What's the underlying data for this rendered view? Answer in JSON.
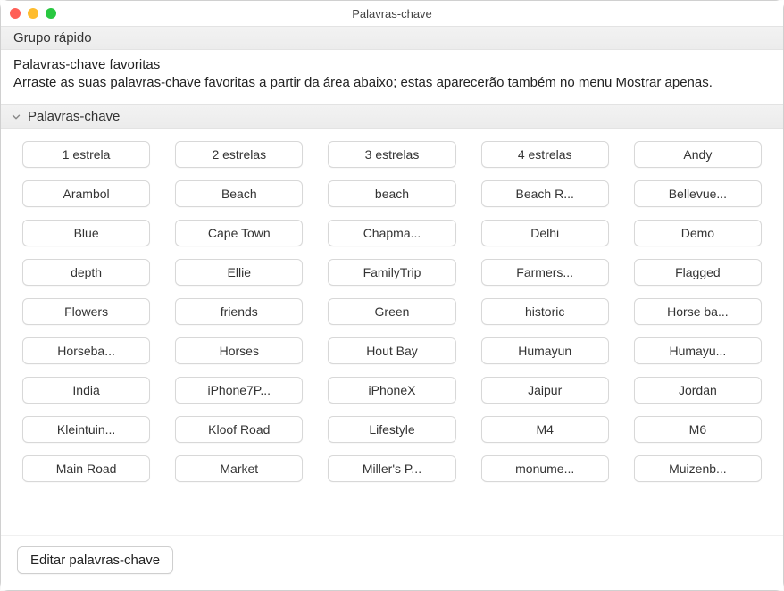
{
  "window": {
    "title": "Palavras-chave"
  },
  "sections": {
    "quick_group": "Grupo rápido",
    "keywords_header": "Palavras-chave"
  },
  "favorites": {
    "title": "Palavras-chave favoritas",
    "description": "Arraste as suas palavras-chave favoritas a partir da área abaixo; estas aparecerão também no menu Mostrar apenas."
  },
  "keywords": [
    "1 estrela",
    "2 estrelas",
    "3 estrelas",
    "4 estrelas",
    "Andy",
    "Arambol",
    "Beach",
    "beach",
    "Beach R...",
    "Bellevue...",
    "Blue",
    "Cape Town",
    "Chapma...",
    "Delhi",
    "Demo",
    "depth",
    "Ellie",
    "FamilyTrip",
    "Farmers...",
    "Flagged",
    "Flowers",
    "friends",
    "Green",
    "historic",
    "Horse ba...",
    "Horseba...",
    "Horses",
    "Hout Bay",
    "Humayun",
    "Humayu...",
    "India",
    "iPhone7P...",
    "iPhoneX",
    "Jaipur",
    "Jordan",
    "Kleintuin...",
    "Kloof Road",
    "Lifestyle",
    "M4",
    "M6",
    "Main Road",
    "Market",
    "Miller's P...",
    "monume...",
    "Muizenb..."
  ],
  "footer": {
    "edit_button": "Editar palavras-chave"
  }
}
